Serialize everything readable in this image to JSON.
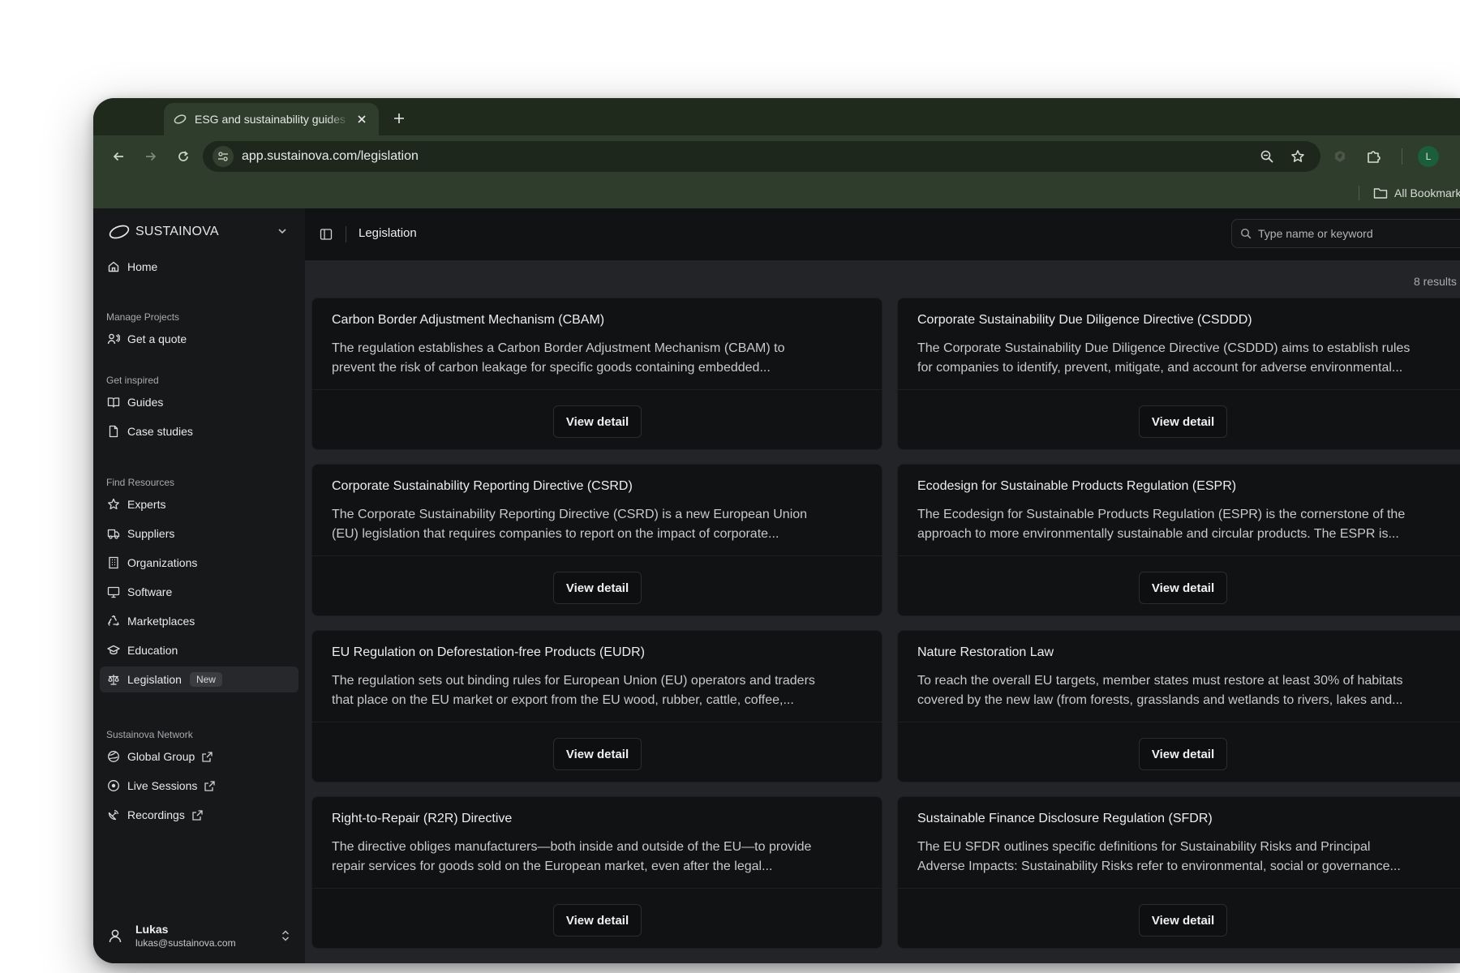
{
  "browser": {
    "tab_title": "ESG and sustainability guides",
    "url": "app.sustainova.com/legislation",
    "avatar_letter": "L",
    "bookmarks_label": "All Bookmarks"
  },
  "sidebar": {
    "brand": "SUSTAINOVA",
    "home": "Home",
    "sections": {
      "manage": "Manage Projects",
      "inspired": "Get inspired",
      "resources": "Find Resources",
      "network": "Sustainova Network"
    },
    "items": {
      "quote": "Get a quote",
      "guides": "Guides",
      "case_studies": "Case studies",
      "experts": "Experts",
      "suppliers": "Suppliers",
      "organizations": "Organizations",
      "software": "Software",
      "marketplaces": "Marketplaces",
      "education": "Education",
      "legislation": "Legislation",
      "legislation_badge": "New",
      "global_group": "Global Group",
      "live_sessions": "Live Sessions",
      "recordings": "Recordings"
    },
    "user": {
      "name": "Lukas",
      "email": "lukas@sustainova.com"
    }
  },
  "main": {
    "title": "Legislation",
    "search_placeholder": "Type name or keyword",
    "results_count": "8 results",
    "view_label": "View detail",
    "cards": [
      {
        "title": "Carbon Border Adjustment Mechanism (CBAM)",
        "line1": "The regulation establishes a Carbon Border Adjustment Mechanism (CBAM) to",
        "line2": "prevent the risk of carbon leakage for specific goods containing embedded..."
      },
      {
        "title": "Corporate Sustainability Due Diligence Directive (CSDDD)",
        "line1": "The Corporate Sustainability Due Diligence Directive (CSDDD) aims to establish rules",
        "line2": "for companies to identify, prevent, mitigate, and account for adverse environmental..."
      },
      {
        "title": "Corporate Sustainability Reporting Directive (CSRD)",
        "line1": "The Corporate Sustainability Reporting Directive (CSRD) is a new European Union",
        "line2": "(EU) legislation that requires companies to report on the impact of corporate..."
      },
      {
        "title": "Ecodesign for Sustainable Products Regulation (ESPR)",
        "line1": "The Ecodesign for Sustainable Products Regulation (ESPR) is the cornerstone of the",
        "line2": "approach to more environmentally sustainable and circular products. The ESPR is..."
      },
      {
        "title": "EU Regulation on Deforestation-free Products (EUDR)",
        "line1": "The regulation sets out binding rules for European Union (EU) operators and traders",
        "line2": "that place on the EU market or export from the EU wood, rubber, cattle, coffee,..."
      },
      {
        "title": "Nature Restoration Law",
        "line1": "To reach the overall EU targets, member states must restore at least 30% of habitats",
        "line2": "covered by the new law (from forests, grasslands and wetlands to rivers, lakes and..."
      },
      {
        "title": "Right-to-Repair (R2R) Directive",
        "line1": "The directive obliges manufacturers—both inside and outside of the EU—to provide",
        "line2": "repair services for goods sold on the European market, even after the legal..."
      },
      {
        "title": "Sustainable Finance Disclosure Regulation (SFDR)",
        "line1": "The EU SFDR outlines specific definitions for Sustainability Risks and Principal",
        "line2": "Adverse Impacts: Sustainability Risks refer to environmental, social or governance..."
      }
    ]
  }
}
